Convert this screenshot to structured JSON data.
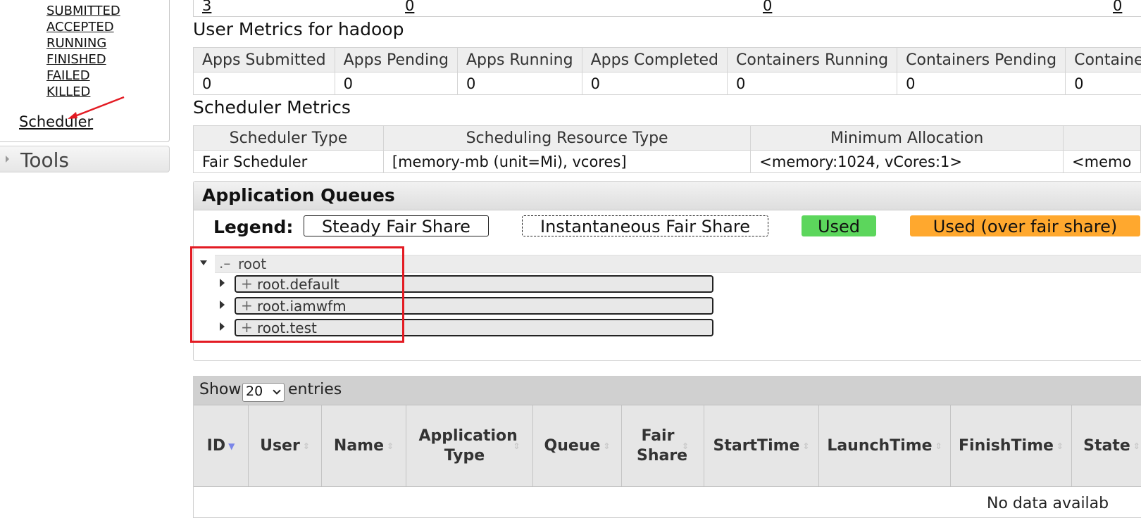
{
  "sidebar": {
    "states": [
      "SUBMITTED",
      "ACCEPTED",
      "RUNNING",
      "FINISHED",
      "FAILED",
      "KILLED"
    ],
    "scheduler_link": "Scheduler",
    "tools_label": "Tools"
  },
  "cluster_row": [
    "3",
    "0",
    "0",
    "0"
  ],
  "user_metrics": {
    "title": "User Metrics for hadoop",
    "headers": [
      "Apps Submitted",
      "Apps Pending",
      "Apps Running",
      "Apps Completed",
      "Containers Running",
      "Containers Pending",
      "Containers"
    ],
    "values": [
      "0",
      "0",
      "0",
      "0",
      "0",
      "0",
      "0"
    ]
  },
  "scheduler_metrics": {
    "title": "Scheduler Metrics",
    "headers": [
      "Scheduler Type",
      "Scheduling Resource Type",
      "Minimum Allocation",
      ""
    ],
    "values": [
      "Fair Scheduler",
      "[memory-mb (unit=Mi), vcores]",
      "<memory:1024, vCores:1>",
      "<memo"
    ]
  },
  "application_queues": {
    "title": "Application Queues",
    "legend_label": "Legend:",
    "legend": {
      "steady": "Steady Fair Share",
      "instantaneous": "Instantaneous Fair Share",
      "used": "Used",
      "over": "Used (over fair share)"
    },
    "root_dash": ".–",
    "root": "root",
    "children": [
      "root.default",
      "root.iamwfm",
      "root.test"
    ],
    "plus": "+",
    "colors": {
      "used": "#5cd65c",
      "over": "#ffa82e",
      "highlight": "#e31b23"
    }
  },
  "apps_table": {
    "show_label": "Show",
    "page_size": "20",
    "entries_label": "entries",
    "columns": [
      "ID",
      "User",
      "Name",
      "Application Type",
      "Queue",
      "Fair Share",
      "StartTime",
      "LaunchTime",
      "FinishTime",
      "State"
    ],
    "empty_text": "No data availab"
  }
}
